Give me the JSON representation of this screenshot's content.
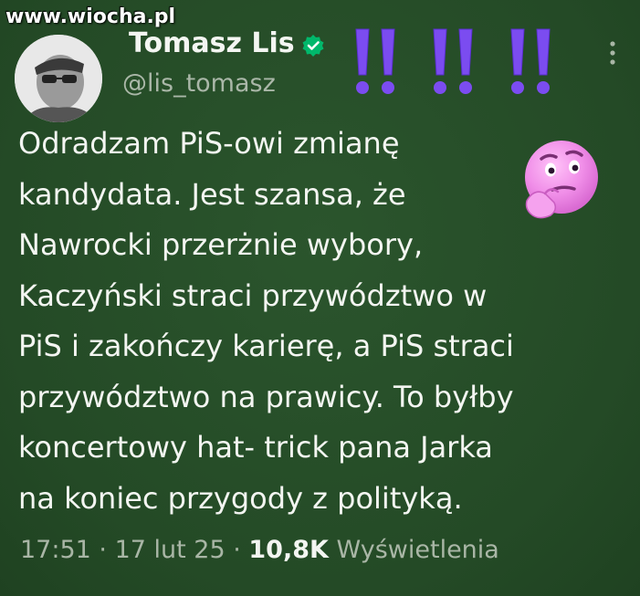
{
  "watermark": "www.wiocha.pl",
  "author": {
    "name": "Tomasz Lis",
    "handle": "@lis_tomasz"
  },
  "tweet": {
    "lines": [
      "Odradzam PiS-owi zmianę",
      "kandydata. Jest szansa, że",
      "Nawrocki przerżnie wybory,",
      "Kaczyński straci przywództwo w",
      "PiS i zakończy karierę, a PiS straci",
      "przywództwo na prawicy. To byłby",
      "koncertowy hat- trick pana Jarka",
      "na koniec przygody z polityką."
    ]
  },
  "meta": {
    "time": "17:51",
    "sep1": " · ",
    "date": "17 lut 25",
    "sep2": " · ",
    "views": "10,8K",
    "views_label": " Wyświetlenia"
  },
  "icons": {
    "verified": "verified-badge-icon",
    "exclamations": "double-exclamation-icon",
    "emoji": "thinking-face-emoji-icon",
    "more": "more-options-icon"
  },
  "colors": {
    "background": "#264d28",
    "verified": "#00b86b",
    "exclaim": "#7b4cf0",
    "emoji": "#f08ee8"
  }
}
